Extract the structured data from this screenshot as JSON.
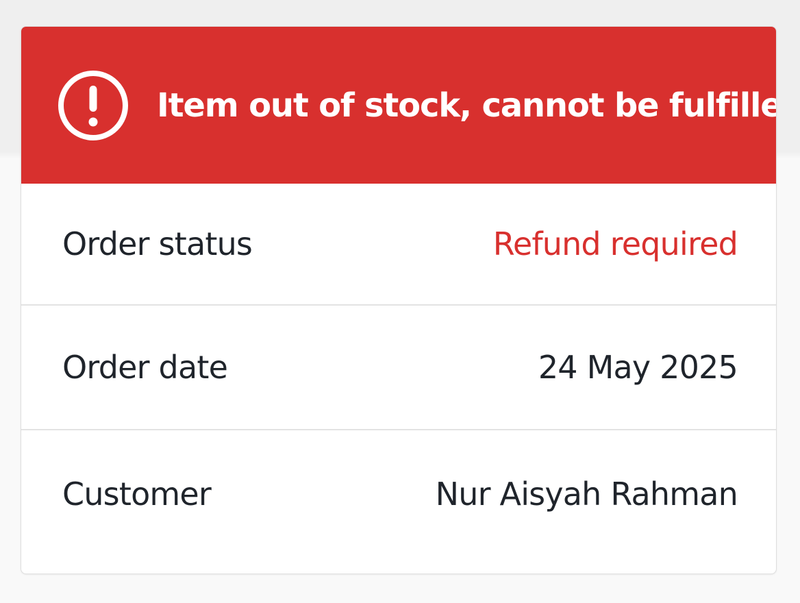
{
  "alert": {
    "icon": "alert-circle-icon",
    "message": "Item out of stock, cannot be fulfilled",
    "color": "#d8302e"
  },
  "details": [
    {
      "label": "Order status",
      "value": "Refund required",
      "value_color": "#d8302e"
    },
    {
      "label": "Order date",
      "value": "24 May 2025"
    },
    {
      "label": "Customer",
      "value": "Nur Aisyah Rahman"
    }
  ]
}
